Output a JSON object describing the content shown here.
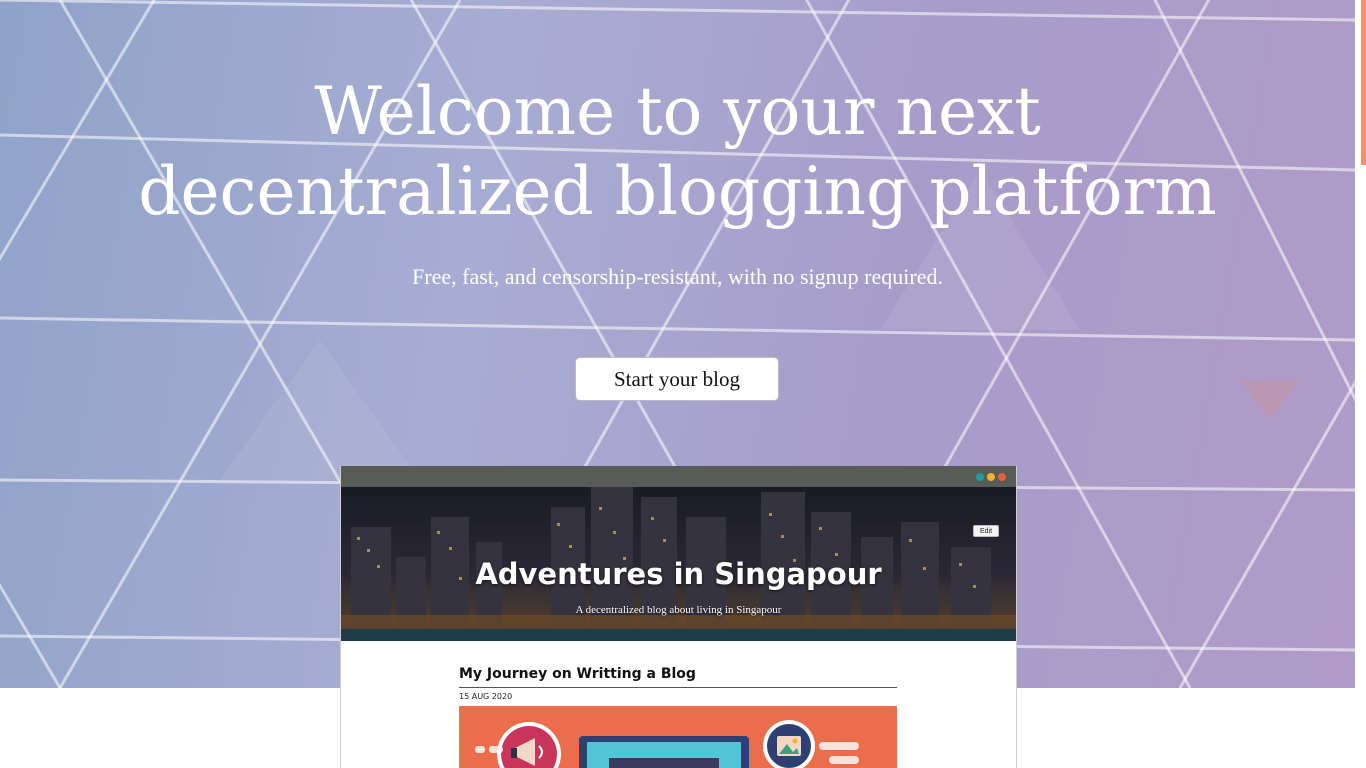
{
  "hero": {
    "title_line1": "Welcome to your next",
    "title_line2": "decentralized blogging platform",
    "subtitle": "Free, fast, and censorship-resistant, with no signup required.",
    "cta_label": "Start your blog"
  },
  "preview": {
    "window_dots": [
      "#1aa39a",
      "#f0b429",
      "#e8613c"
    ],
    "edit_label": "Edit",
    "blog_title": "Adventures in Singapour",
    "blog_subtitle": "A decentralized blog about living in Singapour",
    "post": {
      "title": "My Journey on Writting a Blog",
      "date": "15 AUG 2020"
    }
  },
  "colors": {
    "accent": "#f0916a",
    "illustration_bg": "#ec6d4c"
  }
}
